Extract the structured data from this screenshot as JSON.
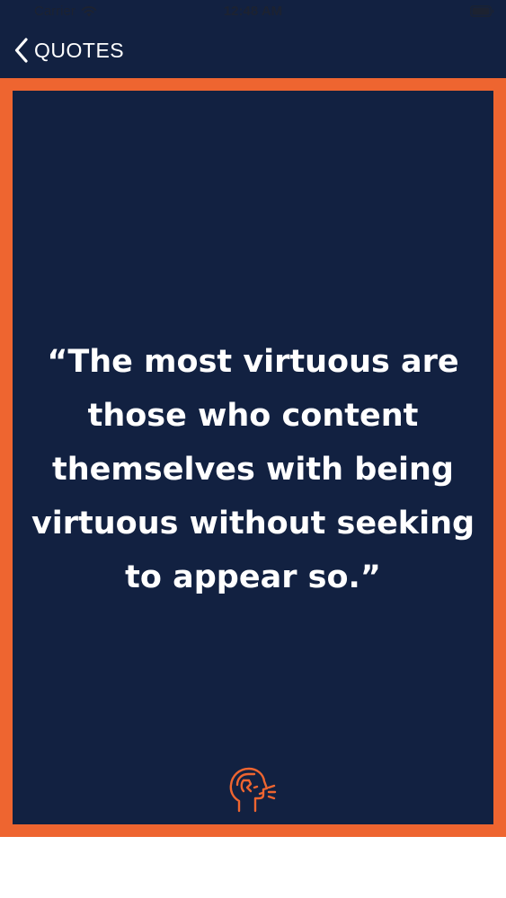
{
  "status_bar": {
    "carrier": "Carrier",
    "time": "12:48 AM"
  },
  "nav": {
    "back_label": "QUOTES"
  },
  "quote": {
    "text": "“The most virtuous are\nthose who content\nthemselves with being\nvirtuous without seeking\nto appear so.”"
  },
  "colors": {
    "navy": "#122141",
    "orange": "#ee6530",
    "white": "#ffffff"
  },
  "icons": {
    "back": "chevron-left-icon",
    "wifi": "wifi-icon",
    "battery": "battery-icon",
    "speaker": "speaking-head-icon"
  }
}
